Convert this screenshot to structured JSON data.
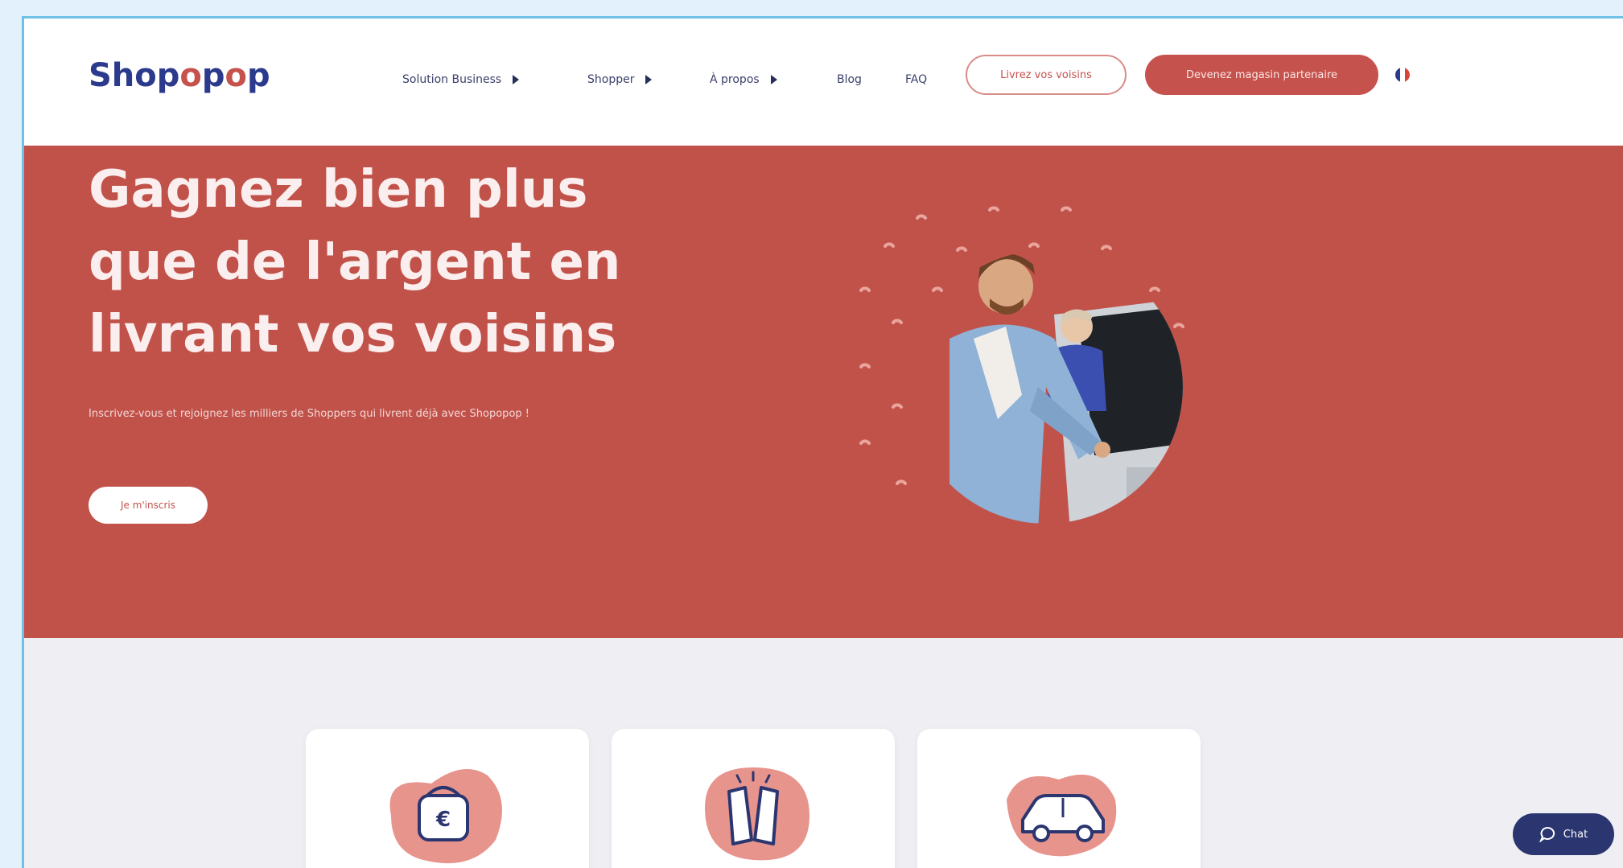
{
  "header": {
    "logo": {
      "part1": "Shop",
      "o1": "o",
      "part2": "p",
      "o2": "o",
      "part3": "p"
    },
    "nav": [
      {
        "label": "Solution Business"
      },
      {
        "label": "Shopper"
      },
      {
        "label": "À propos"
      },
      {
        "label": "Blog"
      },
      {
        "label": "FAQ"
      }
    ],
    "cta_outline": "Livrez vos voisins",
    "cta_solid": "Devenez magasin partenaire",
    "language_flag": "fr-flag-icon"
  },
  "hero": {
    "title_lines": [
      "Gagnez bien plus",
      "que de l'argent en",
      "livrant vos voisins"
    ],
    "subtitle": "Inscrivez-vous et rejoignez les milliers de Shoppers qui livrent déjà avec Shopopop !",
    "button": "Je m'inscris"
  },
  "cards": [
    {
      "icon": "wallet-euro-icon"
    },
    {
      "icon": "high-five-icon"
    },
    {
      "icon": "car-icon"
    }
  ],
  "chat": {
    "label": "Chat"
  },
  "colors": {
    "brand_red": "#c1524a",
    "brand_navy": "#2b3a8c",
    "frame_border": "#6fc2e6"
  }
}
